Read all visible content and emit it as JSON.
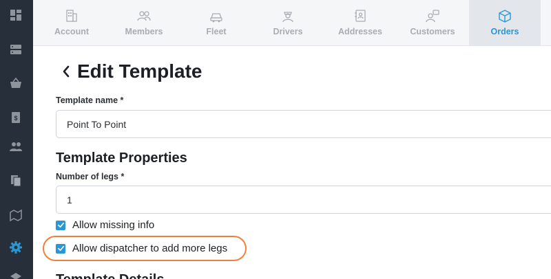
{
  "tabs": [
    {
      "label": "Account",
      "icon": "building-icon",
      "active": false
    },
    {
      "label": "Members",
      "icon": "members-icon",
      "active": false
    },
    {
      "label": "Fleet",
      "icon": "fleet-icon",
      "active": false
    },
    {
      "label": "Drivers",
      "icon": "driver-icon",
      "active": false
    },
    {
      "label": "Addresses",
      "icon": "address-book-icon",
      "active": false
    },
    {
      "label": "Customers",
      "icon": "customers-icon",
      "active": false
    },
    {
      "label": "Orders",
      "icon": "box-icon",
      "active": true
    }
  ],
  "sidebar": {
    "items": [
      {
        "icon": "dashboard-icon",
        "active": false
      },
      {
        "icon": "storage-icon",
        "active": false
      },
      {
        "icon": "basket-icon",
        "active": false
      },
      {
        "icon": "invoice-icon",
        "active": false
      },
      {
        "icon": "people-icon",
        "active": false
      },
      {
        "icon": "documents-icon",
        "active": false
      },
      {
        "icon": "map-icon",
        "active": false
      },
      {
        "icon": "gear-icon",
        "active": true
      }
    ]
  },
  "page": {
    "title": "Edit Template"
  },
  "form": {
    "template_name_label": "Template name *",
    "template_name_value": "Point To Point",
    "properties_heading": "Template Properties",
    "legs_label": "Number of legs *",
    "legs_value": "1",
    "allow_missing_label": "Allow missing info",
    "allow_missing_checked": true,
    "allow_dispatcher_label": "Allow dispatcher to add more legs",
    "allow_dispatcher_checked": true,
    "details_heading": "Template Details"
  },
  "colors": {
    "sidebar_bg": "#27303a",
    "accent": "#2a97d4",
    "highlight": "#f07f3c"
  }
}
